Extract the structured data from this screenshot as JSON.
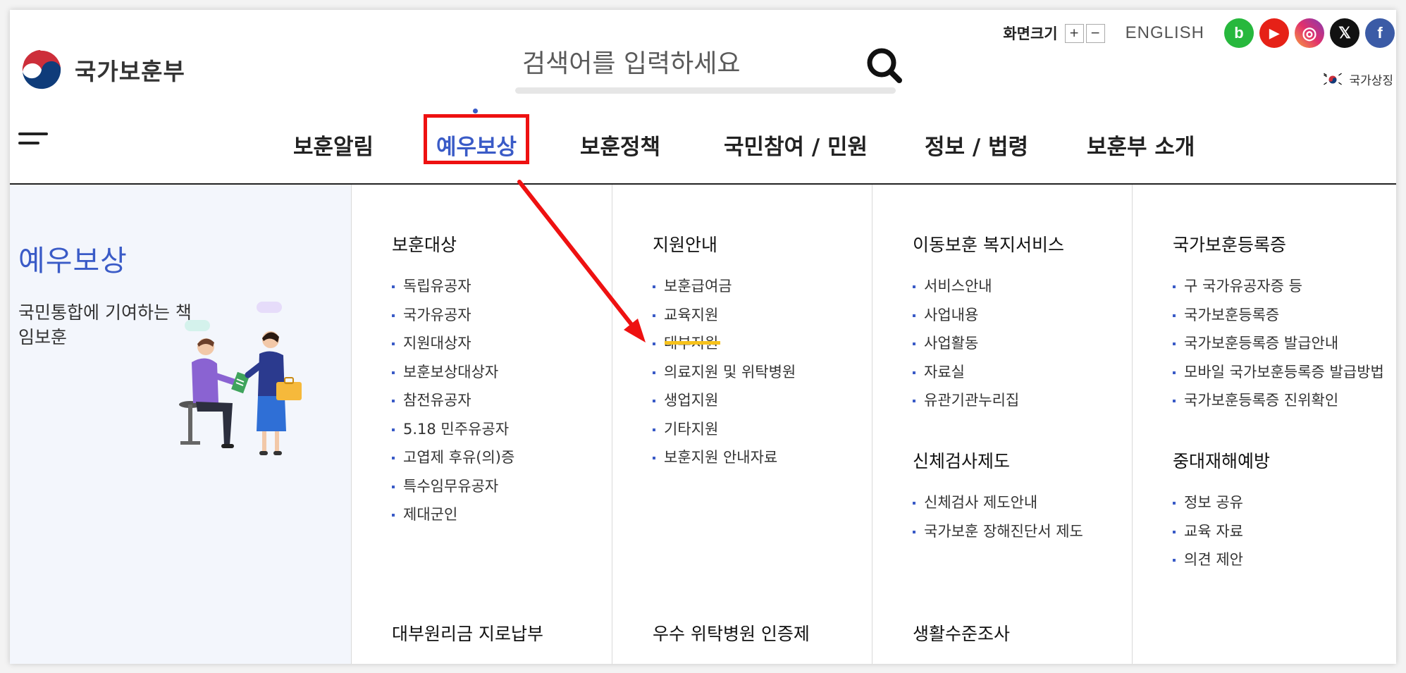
{
  "header": {
    "logo_text": "국가보훈부",
    "search_placeholder": "검색어를 입력하세요",
    "font_size_label": "화면크기",
    "font_plus": "+",
    "font_minus": "−",
    "english_link": "ENGLISH",
    "sns": [
      {
        "name": "blog",
        "glyph": "b",
        "color": "#27b83d"
      },
      {
        "name": "youtube",
        "glyph": "▶",
        "color": "#e62117"
      },
      {
        "name": "instagram",
        "glyph": "◎",
        "color": "#e1306c"
      },
      {
        "name": "x",
        "glyph": "𝕏",
        "color": "#111111"
      },
      {
        "name": "facebook",
        "glyph": "f",
        "color": "#3b5ba6"
      }
    ],
    "national_symbol": "국가상징"
  },
  "gnb": {
    "items": [
      "보훈알림",
      "예우보상",
      "보훈정책",
      "국민참여 / 민원",
      "정보 / 법령",
      "보훈부 소개"
    ],
    "active": "예우보상"
  },
  "mega": {
    "side_title": "예우보상",
    "side_desc": "국민통합에 기여하는 책임보훈",
    "columns": [
      {
        "head": "보훈대상",
        "items": [
          "독립유공자",
          "국가유공자",
          "지원대상자",
          "보훈보상대상자",
          "참전유공자",
          "5.18 민주유공자",
          "고엽제 후유(의)증",
          "특수임무유공자",
          "제대군인"
        ],
        "head2": "대부원리금 지로납부"
      },
      {
        "head": "지원안내",
        "items": [
          "보훈급여금",
          "교육지원",
          "대부지원",
          "의료지원 및 위탁병원",
          "생업지원",
          "기타지원",
          "보훈지원 안내자료"
        ],
        "head2": "우수 위탁병원 인증제"
      },
      {
        "head": "이동보훈 복지서비스",
        "items": [
          "서비스안내",
          "사업내용",
          "사업활동",
          "자료실",
          "유관기관누리집"
        ],
        "head2": "신체검사제도",
        "items2": [
          "신체검사 제도안내",
          "국가보훈 장해진단서 제도"
        ],
        "head3": "생활수준조사"
      },
      {
        "head": "국가보훈등록증",
        "items": [
          "구 국가유공자증 등",
          "국가보훈등록증",
          "국가보훈등록증 발급안내",
          "모바일 국가보훈등록증 발급방법",
          "국가보훈등록증 진위확인"
        ],
        "head2": "중대재해예방",
        "items2": [
          "정보 공유",
          "교육 자료",
          "의견 제안"
        ]
      }
    ]
  },
  "colors": {
    "accent": "#3a5bc7",
    "highlight_box": "#ee1111",
    "underline": "#f7c21b",
    "side_bg": "#f3f6fc"
  }
}
